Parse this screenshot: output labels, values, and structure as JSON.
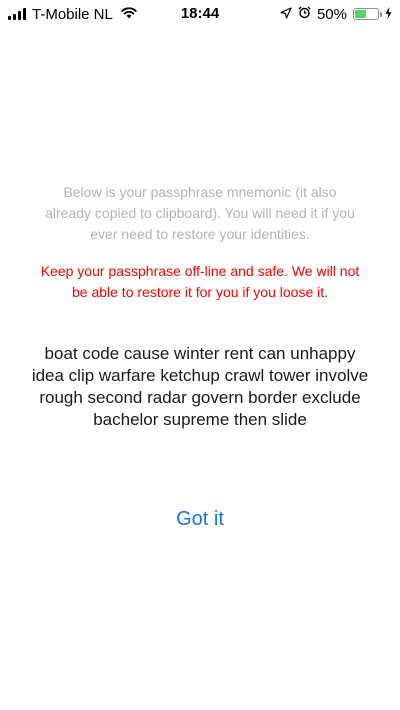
{
  "status_bar": {
    "carrier": "T-Mobile NL",
    "time": "18:44",
    "battery_percent": "50%",
    "battery_level": 0.5,
    "battery_color": "#4cd964",
    "icons": [
      "signal-icon",
      "wifi-icon",
      "location-icon",
      "alarm-icon",
      "battery-icon",
      "charging-icon"
    ]
  },
  "main": {
    "info_text": "Below is your passphrase mnemonic (it also already copied to clipboard). You will need it if you ever need to restore your identities.",
    "warning_text": "Keep your passphrase off-line and safe. We will not be able to restore it for you if you loose it.",
    "mnemonic": "boat code cause winter rent can unhappy idea clip warfare ketchup crawl tower involve rough second radar govern border exclude bachelor supreme then slide",
    "got_it_label": "Got it"
  },
  "colors": {
    "info_text": "#b3b3b3",
    "warning_text": "#ff0000",
    "link": "#1a73e8"
  }
}
